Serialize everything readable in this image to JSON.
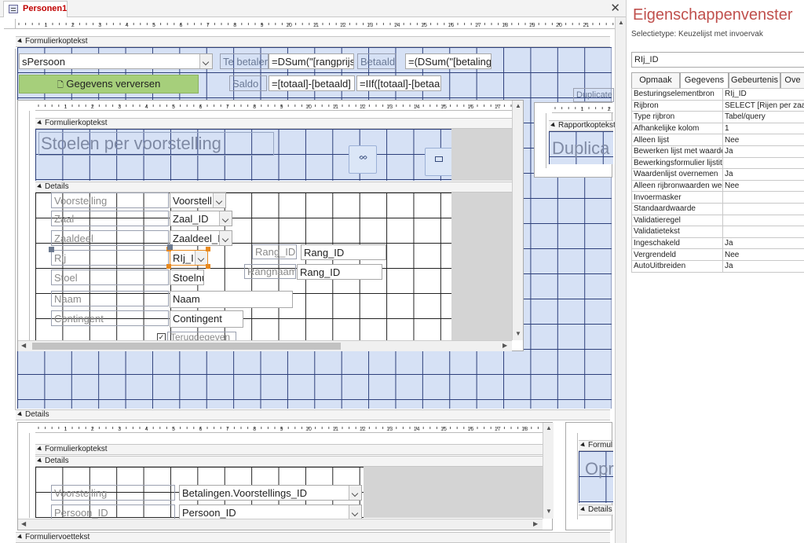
{
  "document_tab": {
    "title": "Personen1"
  },
  "main_form": {
    "header_section": "Formulierkoptekst",
    "combo_persoon": "sPersoon",
    "button_refresh": "Gegevens verversen",
    "label_te_betalen": "Te betalen",
    "text_te_betalen": "=DSum(\"[rangprijs",
    "label_betaald": "Betaald",
    "text_betaald": "=(DSum(\"[betaling",
    "label_saldo": "Saldo",
    "text_saldo": "=[totaal]-[betaald]",
    "text_saldo2": "=IIf([totaal]-[betaa",
    "duplicate_label": "Duplicate",
    "details_section": "Details",
    "footer_section": "Formuliervoettekst"
  },
  "ruler_numbers": [
    "1",
    "2",
    "3",
    "4",
    "5",
    "6",
    "7",
    "8",
    "9",
    "10",
    "11",
    "12",
    "13",
    "14",
    "15",
    "16",
    "17",
    "18",
    "19",
    "20",
    "21"
  ],
  "subform_seats": {
    "header_section": "Formulierkoptekst",
    "title": "Stoelen per voorstelling",
    "details_section": "Details",
    "fields": [
      {
        "label": "Voorstelling",
        "control": "Voorstell"
      },
      {
        "label": "Zaal",
        "control": "Zaal_ID"
      },
      {
        "label": "Zaaldeel",
        "control": "Zaaldeel_I"
      },
      {
        "label": "Rij",
        "control": "RIj_I"
      },
      {
        "label": "Stoel",
        "control": "Stoelnu"
      },
      {
        "label": "Naam",
        "control": "Naam"
      },
      {
        "label": "Contingent",
        "control": "Contingent"
      }
    ],
    "checkbox_label": "Teruggegeven",
    "rang_id_label": "Rang_ID.",
    "rang_id_text": "Rang_ID",
    "rangnaam_label": "Rangnaam",
    "rangnaam_text": "Rang_ID"
  },
  "subform_report": {
    "header_section": "Rapportkoptekst",
    "title": "Duplica"
  },
  "subform_payments": {
    "header_section": "Formulierkoptekst",
    "details_section": "Details",
    "fields": [
      {
        "label": "Voorstelling",
        "control": "Betalingen.Voorstellings_ID"
      },
      {
        "label": "Persoon_ID",
        "control": "Persoon_ID"
      }
    ]
  },
  "subform_right": {
    "header_section": "Formul",
    "title": "Opr",
    "details_section": "Details"
  },
  "property_sheet": {
    "title": "Eigenschappenvenster",
    "selection_type": "Selectietype:  Keuzelijst met invoervak",
    "selected_control": "RIj_ID",
    "tabs": [
      "Opmaak",
      "Gegevens",
      "Gebeurtenis",
      "Ove"
    ],
    "active_tab": "Gegevens",
    "rows": [
      {
        "k": "Besturingselementbron",
        "v": "RIj_ID"
      },
      {
        "k": "Rijbron",
        "v": "SELECT [Rijen per zaal e"
      },
      {
        "k": "Type rijbron",
        "v": "Tabel/query"
      },
      {
        "k": "Afhankelijke kolom",
        "v": "1"
      },
      {
        "k": "Alleen lijst",
        "v": "Nee"
      },
      {
        "k": "Bewerken lijst met waarden",
        "v": "Ja"
      },
      {
        "k": "Bewerkingsformulier lijstitems",
        "v": ""
      },
      {
        "k": "Waardenlijst overnemen",
        "v": "Ja"
      },
      {
        "k": "Alleen rijbronwaarden weergeven",
        "v": "Nee"
      },
      {
        "k": "Invoermasker",
        "v": ""
      },
      {
        "k": "Standaardwaarde",
        "v": ""
      },
      {
        "k": "Validatieregel",
        "v": ""
      },
      {
        "k": "Validatietekst",
        "v": ""
      },
      {
        "k": "Ingeschakeld",
        "v": "Ja"
      },
      {
        "k": "Vergrendeld",
        "v": "Nee"
      },
      {
        "k": "AutoUitbreiden",
        "v": "Ja"
      }
    ]
  },
  "colors": {
    "accent": "#c0504d",
    "grid_fill": "#d6e1f5",
    "button_green": "#a6cf7b",
    "selection": "#e8891e"
  }
}
